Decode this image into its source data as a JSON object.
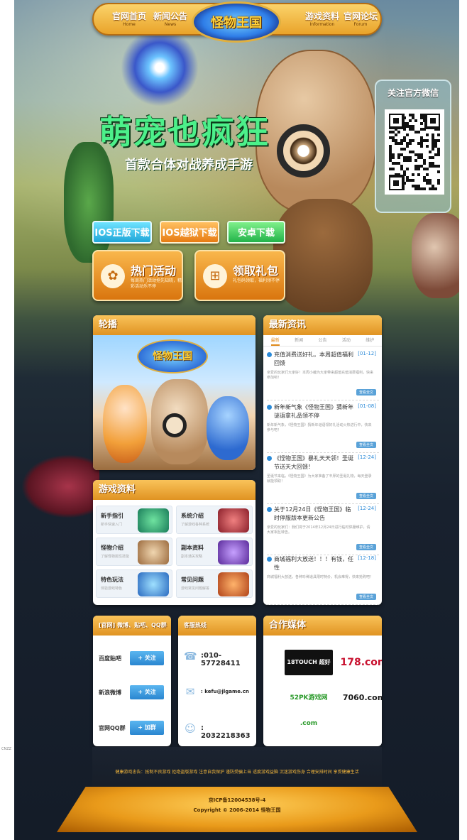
{
  "nav": {
    "items": [
      {
        "zh": "官网首页",
        "en": "Home"
      },
      {
        "zh": "新闻公告",
        "en": "News"
      },
      {
        "zh": "游戏资料",
        "en": "Information"
      },
      {
        "zh": "官网论坛",
        "en": "Forum"
      }
    ],
    "logo_text": "怪物王国"
  },
  "hero": {
    "slogan": "萌宠也疯狂",
    "subslogan": "首款合体对战养成手游"
  },
  "wechat": {
    "title": "关注官方微信"
  },
  "downloads": {
    "ios_official": "IOS正版下载",
    "ios_jailbreak": "IOS越狱下载",
    "android": "安卓下载"
  },
  "promo": {
    "activity": {
      "title": "热门活动",
      "desc": "每周热门活动抢先知晓，精彩活动乐不停"
    },
    "gift": {
      "title": "领取礼包",
      "desc": "礼包码领取，福利领不停"
    }
  },
  "carousel": {
    "title": "轮播",
    "banner_logo": "怪物王国"
  },
  "news": {
    "title": "最新资讯",
    "tabs": [
      "最新",
      "新闻",
      "公告",
      "活动",
      "维护"
    ],
    "items": [
      {
        "title": "充值消费送好礼，本周超值福利回馈",
        "date": "[01-12]",
        "summary": "亲爱的玩家们大家好！本周小编为大家带来超值充值消费福利，快来参加吧！",
        "more": "查看全文"
      },
      {
        "title": "新年新气象《怪物王国》猜新年谜语拿礼品领不停",
        "date": "[01-08]",
        "summary": "新年新气象，《怪物王国》猜新年谜语领好礼活动火热进行中，快来参与吧！",
        "more": "查看全文"
      },
      {
        "title": "《怪物王国》暴礼天天领！圣诞节送天大回馈！",
        "date": "[12-24]",
        "summary": "圣诞节来临，《怪物王国》为大家准备了丰厚的圣诞礼物，每天登录就能领取！",
        "more": "查看全文"
      },
      {
        "title": "关于12月24日《怪物王国》临时停服版本更新公告",
        "date": "[12-24]",
        "summary": "亲爱的玩家们：我们将于2014年12月24日进行临时停服维护，请大家相互转告。",
        "more": "查看全文"
      },
      {
        "title": "商城福利大放送！！！有钱，任性",
        "date": "[12-18]",
        "summary": "商城福利大放送，各种珍稀道具限时特价，机会难得，快来抢购吧！",
        "more": "查看全文"
      }
    ]
  },
  "gamedata": {
    "title": "游戏资料",
    "cells": [
      {
        "title": "新手指引",
        "sub": "新手快速入门"
      },
      {
        "title": "系统介绍",
        "sub": "了解游戏各种系统"
      },
      {
        "title": "怪物介绍",
        "sub": "了解怪物属性技能"
      },
      {
        "title": "副本资料",
        "sub": "副本通关攻略"
      },
      {
        "title": "特色玩法",
        "sub": "体验游戏特色"
      },
      {
        "title": "常见问题",
        "sub": "游戏常见问题解答"
      }
    ]
  },
  "social": {
    "title": "[官网] 微博、贴吧、QQ群",
    "rows": [
      {
        "label": "百度贴吧",
        "btn": "+ 关注"
      },
      {
        "label": "新浪微博",
        "btn": "+ 关注"
      },
      {
        "label": "官网QQ群",
        "btn": "+ 加群"
      }
    ]
  },
  "service": {
    "title": "客服热线",
    "phone": ":010-57728411",
    "email": ": kefu@jlgame.cn",
    "qq": ": 2032218363"
  },
  "media": {
    "title": "合作媒体",
    "logos": [
      "18TOUCH 超好玩",
      "178.com",
      "52PK游戏网 .com",
      "7060.com"
    ]
  },
  "footer": {
    "links": "健康游戏忠告：抵制不良游戏 拒绝盗版游戏 注意自我保护 谨防受骗上当 适度游戏益脑 沉迷游戏伤身 合理安排时间 享受健康生活",
    "icp": "京ICP备12004538号-4",
    "copyright": "Copyright © 2006-2014 怪物王国"
  },
  "side_tag": "CNZZ"
}
